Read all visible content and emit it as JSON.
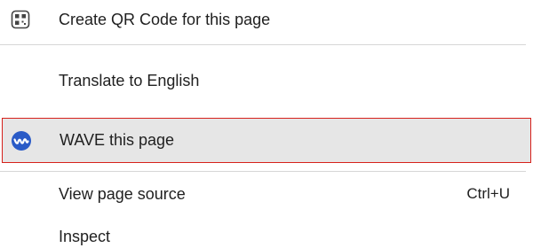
{
  "context_menu": {
    "items": [
      {
        "label": "Create QR Code for this page",
        "icon": "qr-code-icon"
      },
      {
        "label": "Translate to English"
      },
      {
        "label": "WAVE this page",
        "icon": "wave-extension-icon",
        "highlighted": true
      },
      {
        "label": "View page source",
        "shortcut": "Ctrl+U"
      },
      {
        "label": "Inspect"
      }
    ]
  },
  "colors": {
    "highlight_background": "#e6e6e6",
    "highlight_border": "#d6211b",
    "wave_icon": "#2a5bc7",
    "separator": "#d6d6d6"
  }
}
